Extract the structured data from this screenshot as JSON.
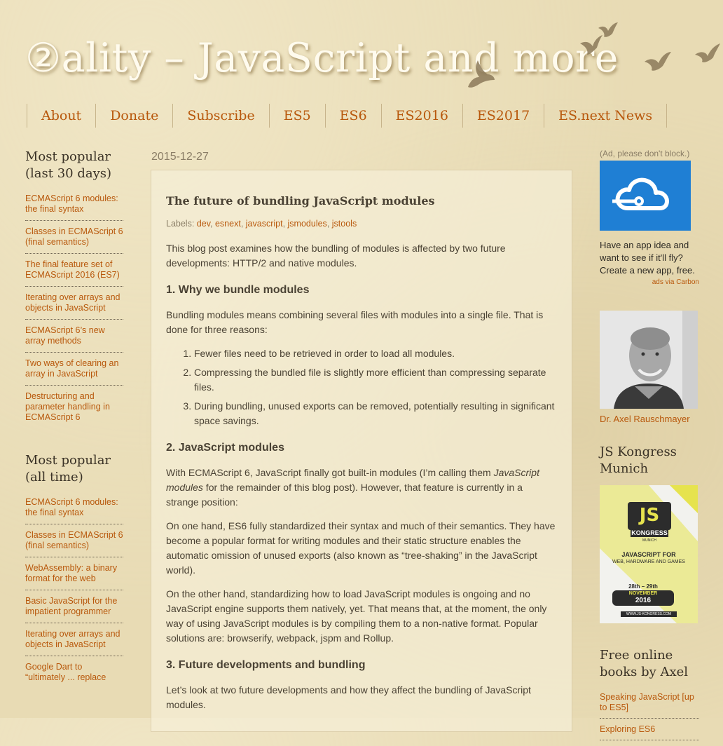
{
  "site": {
    "title": "②ality – JavaScript and more"
  },
  "nav": {
    "items": [
      "About",
      "Donate",
      "Subscribe",
      "ES5",
      "ES6",
      "ES2016",
      "ES2017",
      "ES.next News"
    ]
  },
  "left_sidebar": {
    "popular_30": {
      "heading": "Most popular (last 30 days)",
      "items": [
        "ECMAScript 6 modules: the final syntax",
        "Classes in ECMAScript 6 (final semantics)",
        "The final feature set of ECMAScript 2016 (ES7)",
        "Iterating over arrays and objects in JavaScript",
        "ECMAScript 6’s new array methods",
        "Two ways of clearing an array in JavaScript",
        "Destructuring and parameter handling in ECMAScript 6"
      ]
    },
    "popular_all": {
      "heading": "Most popular (all time)",
      "items": [
        "ECMAScript 6 modules: the final syntax",
        "Classes in ECMAScript 6 (final semantics)",
        "WebAssembly: a binary format for the web",
        "Basic JavaScript for the impatient programmer",
        "Iterating over arrays and objects in JavaScript",
        "Google Dart to “ultimately ... replace"
      ]
    }
  },
  "post": {
    "date": "2015-12-27",
    "title": "The future of bundling JavaScript modules",
    "labels_prefix": "Labels:",
    "labels": [
      "dev",
      "esnext",
      "javascript",
      "jsmodules",
      "jstools"
    ],
    "intro": "This blog post examines how the bundling of modules is affected by two future developments: HTTP/2 and native modules.",
    "h1": "1.  Why we bundle modules",
    "p1": "Bundling modules means combining several files with modules into a single file. That is done for three reasons:",
    "reasons": [
      "Fewer files need to be retrieved in order to load all modules.",
      "Compressing the bundled file is slightly more efficient than compressing separate files.",
      "During bundling, unused exports can be removed, potentially resulting in significant space savings."
    ],
    "h2": "2.  JavaScript modules",
    "p2_a": "With ECMAScript 6, JavaScript finally got built-in modules (I’m calling them ",
    "p2_em": "JavaScript modules",
    "p2_b": " for the remainder of this blog post). However, that feature is currently in a strange position:",
    "p3": "On one hand, ES6 fully standardized their syntax and much of their semantics. They have become a popular format for writing modules and their static structure enables the automatic omission of unused exports (also known as “tree-shaking” in the JavaScript world).",
    "p4": "On the other hand, standardizing how to load JavaScript modules is ongoing and no JavaScript engine supports them natively, yet. That means that, at the moment, the only way of using JavaScript modules is by compiling them to a non-native format. Popular solutions are: browserify, webpack, jspm and Rollup.",
    "h3": "3.  Future developments and bundling",
    "p5": "Let’s look at two future developments and how they affect the bundling of JavaScript modules."
  },
  "right_sidebar": {
    "ad_note": "(Ad, please don't block.)",
    "ad_text": "Have an app idea and want to see if it'll fly? Create a new app, free.",
    "ad_via": "ads via Carbon",
    "author_name": "Dr. Axel Rauschmayer",
    "kongress_heading": "JS Kongress Munich",
    "kongress_banner": {
      "logo": "JS",
      "brand": "KONGRESS",
      "city": "MUNICH",
      "tagline_1": "JAVASCRIPT FOR",
      "tagline_2": "WEB, HARDWARE AND GAMES",
      "dates": "28th – 29th",
      "month": "NOVEMBER",
      "year": "2016",
      "url": "WWW.JS-KONGRESS.COM"
    },
    "books_heading": "Free online books by Axel",
    "books": [
      "Speaking JavaScript [up to ES5]",
      "Exploring ES6"
    ]
  },
  "colors": {
    "background": "#e8dbb4",
    "link": "#b8580c",
    "text": "#3a3226",
    "ad_blue": "#1f7fd4",
    "banner_yellow": "#e6e34e"
  }
}
